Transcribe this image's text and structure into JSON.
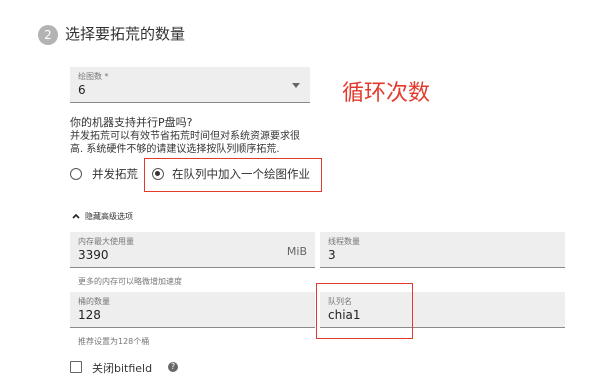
{
  "step": {
    "number": "2",
    "title": "选择要拓荒的数量"
  },
  "plot_count": {
    "label": "绘图数 *",
    "value": "6"
  },
  "annotation": {
    "text": "循环次数"
  },
  "parallel": {
    "question": "你的机器支持并行P盘吗?",
    "description_line1": "并发拓荒可以有效节省拓荒时间但对系统资源要求很",
    "description_line2": "高. 系统硬件不够的请建议选择按队列顺序拓荒.",
    "option_parallel": "并发拓荒",
    "option_queue": "在队列中加入一个绘图作业",
    "selected": "queue"
  },
  "advanced": {
    "toggle_label": "隐藏高级选项"
  },
  "memory": {
    "label": "内存最大使用量",
    "value": "3390",
    "suffix": "MiB",
    "helper": "更多的内存可以略微增加速度"
  },
  "threads": {
    "label": "线程数量",
    "value": "3"
  },
  "buckets": {
    "label": "桶的数量",
    "value": "128",
    "helper": "推荐设置为128个桶"
  },
  "queue_name": {
    "label": "队列名",
    "value": "chia1"
  },
  "bitfield": {
    "label": "关闭bitfield",
    "checked": false
  },
  "colors": {
    "annotation": "#e23a2d",
    "field_bg": "#eeeeee"
  },
  "icons": {
    "dropdown": "chevron-down-icon",
    "advanced_toggle": "chevron-up-icon",
    "help": "help-icon"
  }
}
